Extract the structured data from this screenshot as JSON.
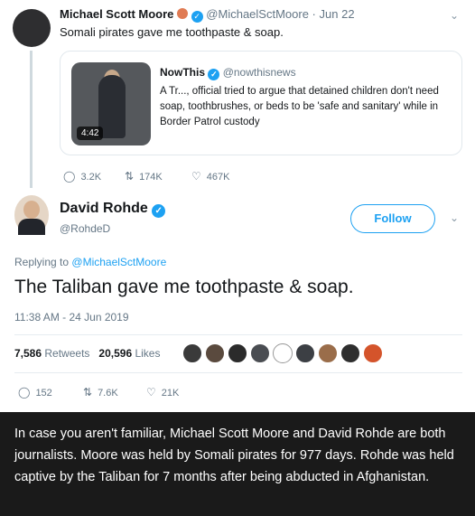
{
  "parent_tweet": {
    "name": "Michael Scott Moore",
    "handle": "@MichaelSctMoore",
    "date": "Jun 22",
    "text": "Somali pirates gave me toothpaste & soap.",
    "quoted": {
      "name": "NowThis",
      "handle": "@nowthisnews",
      "duration": "4:42",
      "text": "A Tr..., official tried to argue that detained children don't need soap, toothbrushes, or beds to be 'safe and sanitary' while in Border Patrol custody"
    },
    "actions": {
      "replies": "3.2K",
      "retweets": "174K",
      "likes": "467K"
    }
  },
  "main_tweet": {
    "name": "David Rohde",
    "handle": "@RohdeD",
    "follow_label": "Follow",
    "replying_prefix": "Replying to",
    "replying_to": "@MichaelSctMoore",
    "text": "The Taliban gave me toothpaste & soap.",
    "timestamp": "11:38 AM - 24 Jun 2019",
    "retweets_count": "7,586",
    "retweets_label": "Retweets",
    "likes_count": "20,596",
    "likes_label": "Likes",
    "actions": {
      "replies": "152",
      "retweets": "7.6K",
      "likes": "21K"
    }
  },
  "liker_avatar_colors": [
    "#3a3a3a",
    "#5a4a3e",
    "#2b2b2b",
    "#4a4d52",
    "#ffffff",
    "#3c3f44",
    "#9a6d4a",
    "#2e2e2e",
    "#d4542b"
  ],
  "caption": "In case you aren't familiar, Michael Scott Moore and David Rohde are both journalists. Moore was held by Somali pirates for 977 days. Rohde was held captive by the Taliban for 7 months after being abducted in Afghanistan."
}
